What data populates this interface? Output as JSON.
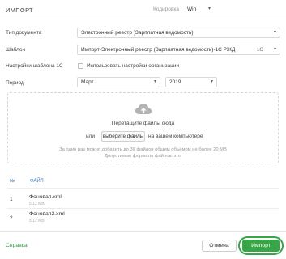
{
  "header": {
    "title": "ИМПОРТ",
    "encoding_label": "Кодировка",
    "encoding_value": "Win"
  },
  "form": {
    "doc_type": {
      "label": "Тип документа",
      "value": "Электронный реестр (Зарплатная ведомость)"
    },
    "template": {
      "label": "Шаблон",
      "value": "Импорт-Электронный реестр (Зарплатная ведомость)-1С РЖД",
      "code": "1С"
    },
    "template_settings": {
      "label": "Настройки шаблона 1С",
      "checkbox_label": "Использовать настройки организации"
    },
    "period": {
      "label": "Период",
      "month": "Март",
      "year": "2019"
    }
  },
  "dropzone": {
    "icon": "cloud-upload-icon",
    "drag_text": "Перетащите файлы сюда",
    "or_text": "или",
    "choose_button": "выберите файлы",
    "on_computer": "на вашем компьютере",
    "limit_hint": "За один раз можно добавить до 30 файлов общим объёмом не более 20 МВ",
    "formats_hint": "Допустимые форматы файлов: xml"
  },
  "files_table": {
    "columns": [
      "№",
      "ФАЙЛ"
    ],
    "rows": [
      {
        "num": "1",
        "name": "Фоновая.xml",
        "size": "5.12 MB"
      },
      {
        "num": "2",
        "name": "Фоновая2.xml",
        "size": "5.12 MB"
      }
    ]
  },
  "footer": {
    "help": "Справка",
    "cancel": "Отмена",
    "import": "Импорт"
  },
  "colors": {
    "accent_green": "#38a646",
    "link_blue": "#3a7bb8"
  }
}
